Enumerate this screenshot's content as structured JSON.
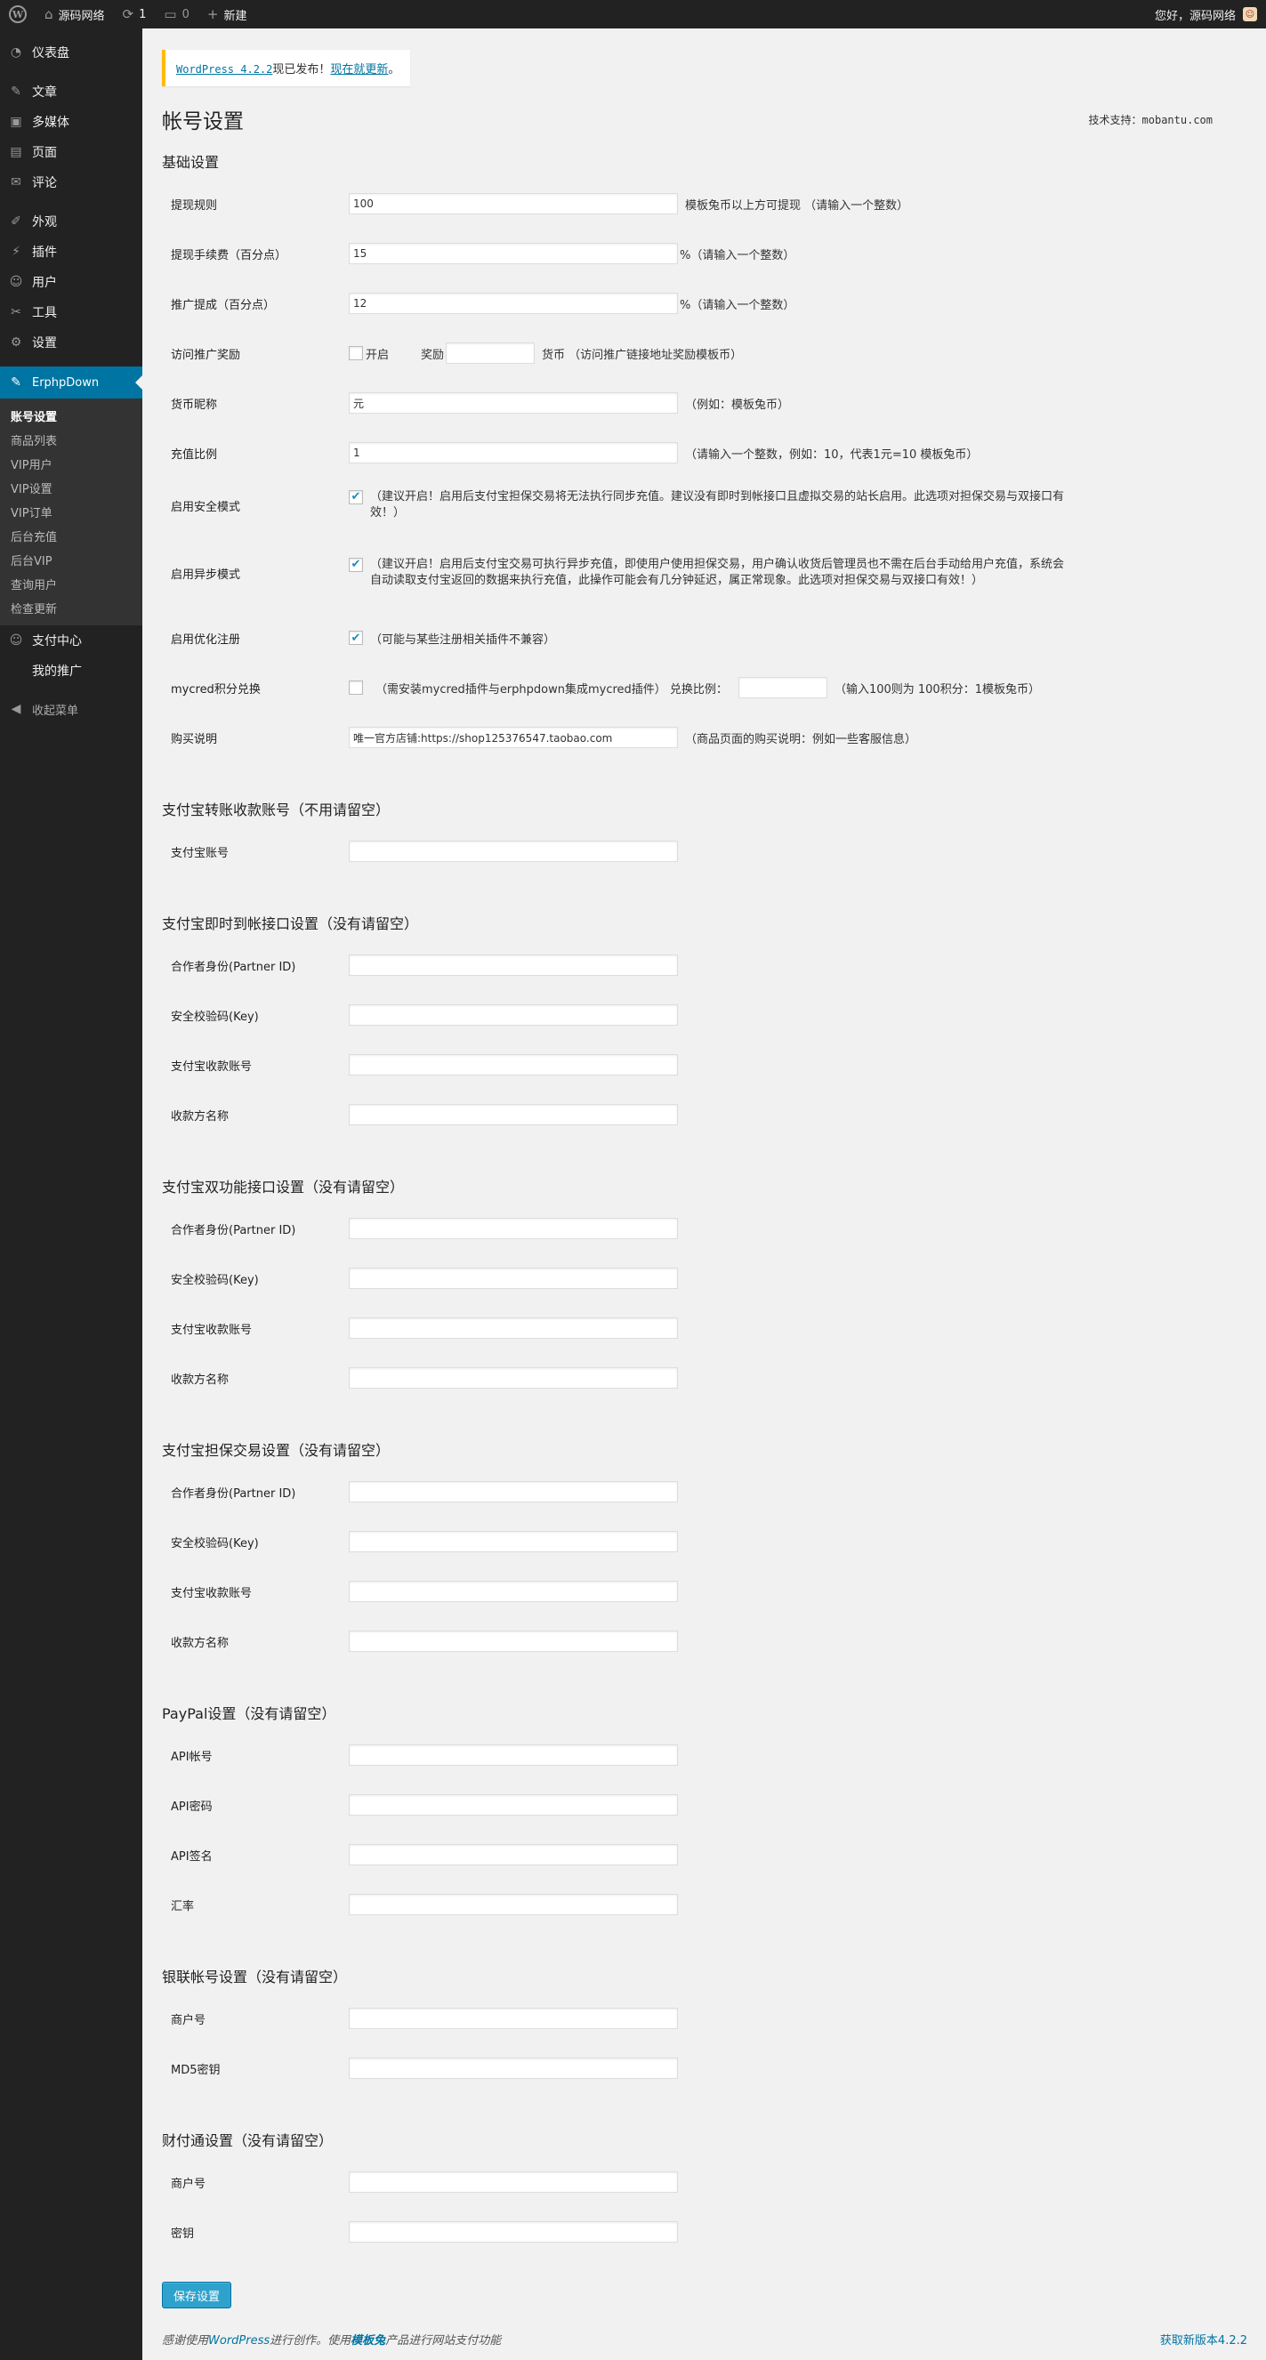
{
  "adminbar": {
    "wp_logo": "W",
    "site_name": "源码网络",
    "updates_count": "1",
    "comments_count": "0",
    "new_label": "新建",
    "greeting": "您好，源码网络"
  },
  "sidebar": {
    "items": [
      {
        "label": "仪表盘",
        "icon": "dashboard-icon",
        "glyph": "◔"
      },
      {
        "label": "文章",
        "icon": "pin-icon",
        "glyph": "✎"
      },
      {
        "label": "多媒体",
        "icon": "media-icon",
        "glyph": "▣"
      },
      {
        "label": "页面",
        "icon": "page-icon",
        "glyph": "▤"
      },
      {
        "label": "评论",
        "icon": "comment-icon",
        "glyph": "✉"
      },
      {
        "label": "外观",
        "icon": "brush-icon",
        "glyph": "✐"
      },
      {
        "label": "插件",
        "icon": "plugin-icon",
        "glyph": "⚡"
      },
      {
        "label": "用户",
        "icon": "user-icon",
        "glyph": "☺"
      },
      {
        "label": "工具",
        "icon": "wrench-icon",
        "glyph": "✂"
      },
      {
        "label": "设置",
        "icon": "settings-icon",
        "glyph": "⚙"
      }
    ],
    "current": {
      "label": "ErphpDown",
      "glyph": "✎"
    },
    "submenu": [
      "账号设置",
      "商品列表",
      "VIP用户",
      "VIP设置",
      "VIP订单",
      "后台充值",
      "后台VIP",
      "查询用户",
      "检查更新"
    ],
    "after": [
      {
        "label": "支付中心",
        "glyph": "☺"
      },
      {
        "label": "我的推广",
        "glyph": ""
      }
    ],
    "collapse_label": "收起菜单",
    "collapse_glyph": "◀"
  },
  "notice": {
    "link1": "WordPress 4.2.2",
    "middle": "现已发布！",
    "link2": "现在就更新",
    "end": "。"
  },
  "page": {
    "title": "帐号设置",
    "support": "技术支持：mobantu.com",
    "save_label": "保存设置"
  },
  "basic": {
    "title": "基础设置",
    "withdraw_rule": {
      "label": "提现规则",
      "value": "100",
      "hint": "模板兔币以上方可提现 （请输入一个整数）"
    },
    "withdraw_fee": {
      "label": "提现手续费（百分点）",
      "value": "15",
      "hint": "%（请输入一个整数）"
    },
    "promo_reward": {
      "label": "推广提成（百分点）",
      "value": "12",
      "hint": "%（请输入一个整数）"
    },
    "visit_reward": {
      "label": "访问推广奖励",
      "enable": "开启",
      "reward": "奖励",
      "currency": "货币 （访问推广链接地址奖励模板币）"
    },
    "currency_name": {
      "label": "货币昵称",
      "value": "元",
      "hint": "（例如：模板兔币）"
    },
    "recharge_ratio": {
      "label": "充值比例",
      "value": "1",
      "hint": "（请输入一个整数，例如：10，代表1元=10 模板兔币）"
    },
    "safe_mode": {
      "label": "启用安全模式",
      "hint": "（建议开启！启用后支付宝担保交易将无法执行同步充值。建议没有即时到帐接口且虚拟交易的站长启用。此选项对担保交易与双接口有效！）"
    },
    "async_mode": {
      "label": "启用异步模式",
      "hint": "（建议开启！启用后支付宝交易可执行异步充值，即使用户使用担保交易，用户确认收货后管理员也不需在后台手动给用户充值，系统会自动读取支付宝返回的数据来执行充值，此操作可能会有几分钟延迟，属正常现象。此选项对担保交易与双接口有效！）"
    },
    "optimize_reg": {
      "label": "启用优化注册",
      "hint": "（可能与某些注册相关插件不兼容）"
    },
    "mycred": {
      "label": "mycred积分兑换",
      "hint1": "（需安装mycred插件与erphpdown集成mycred插件） 兑换比例：",
      "hint2": "（输入100则为 100积分：1模板兔币）"
    },
    "purchase_desc": {
      "label": "购买说明",
      "value": "唯一官方店铺:https://shop125376547.taobao.com",
      "hint": "（商品页面的购买说明：例如一些客服信息）"
    }
  },
  "alipay_transfer": {
    "title": "支付宝转账收款账号（不用请留空）",
    "account": "支付宝账号"
  },
  "alipay_instant": {
    "title": "支付宝即时到帐接口设置（没有请留空）",
    "partner": "合作者身份(Partner ID)",
    "key": "安全校验码(Key)",
    "account": "支付宝收款账号",
    "payee": "收款方名称"
  },
  "alipay_dual": {
    "title": "支付宝双功能接口设置（没有请留空）",
    "partner": "合作者身份(Partner ID)",
    "key": "安全校验码(Key)",
    "account": "支付宝收款账号",
    "payee": "收款方名称"
  },
  "alipay_escrow": {
    "title": "支付宝担保交易设置（没有请留空）",
    "partner": "合作者身份(Partner ID)",
    "key": "安全校验码(Key)",
    "account": "支付宝收款账号",
    "payee": "收款方名称"
  },
  "paypal": {
    "title": "PayPal设置（没有请留空）",
    "api_account": "API帐号",
    "api_password": "API密码",
    "api_signature": "API签名",
    "rate": "汇率"
  },
  "unionpay": {
    "title": "银联帐号设置（没有请留空）",
    "merchant": "商户号",
    "md5": "MD5密钥"
  },
  "tenpay": {
    "title": "财付通设置（没有请留空）",
    "merchant": "商户号",
    "key": "密钥"
  },
  "footer": {
    "pre": "感谢使用",
    "wp": "WordPress",
    "mid": "进行创作。使用",
    "mbt": "模板兔",
    "post": "产品进行网站支付功能",
    "version": "获取新版本4.2.2"
  }
}
